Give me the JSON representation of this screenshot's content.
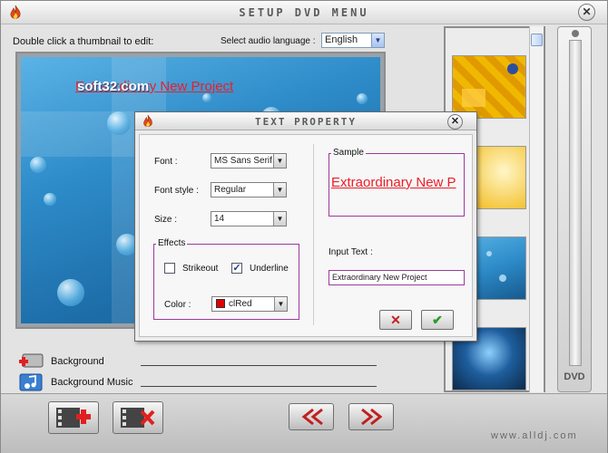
{
  "window": {
    "title": "SETUP DVD MENU",
    "close_glyph": "✕"
  },
  "header": {
    "hint": "Double click a thumbnail to edit:",
    "audio_label": "Select audio language :",
    "audio_value": "English"
  },
  "preview": {
    "title_text": "Extraordinary New Project",
    "watermark": "soft32.com"
  },
  "options": [
    {
      "label": "Background",
      "icon": "add-background-icon"
    },
    {
      "label": "Background Music",
      "icon": "music-note-icon"
    }
  ],
  "side": {
    "dvd_label": "DVD"
  },
  "footer": {
    "site": "www.alldj.com"
  },
  "dialog": {
    "title": "TEXT PROPERTY",
    "close_glyph": "✕",
    "font_label": "Font :",
    "font_value": "MS Sans Serif",
    "style_label": "Font style :",
    "style_value": "Regular",
    "size_label": "Size :",
    "size_value": "14",
    "effects_legend": "Effects",
    "strikeout_label": "Strikeout",
    "strikeout_checked": false,
    "underline_label": "Underline",
    "underline_checked": true,
    "color_label": "Color :",
    "color_value": "clRed",
    "color_hex": "#e00000",
    "sample_legend": "Sample",
    "sample_text": "Extraordinary New P",
    "input_label": "Input Text :",
    "input_value": "Extraordinary New Project",
    "check_glyph": "✓",
    "cancel_glyph": "✕",
    "ok_glyph": "✔"
  }
}
